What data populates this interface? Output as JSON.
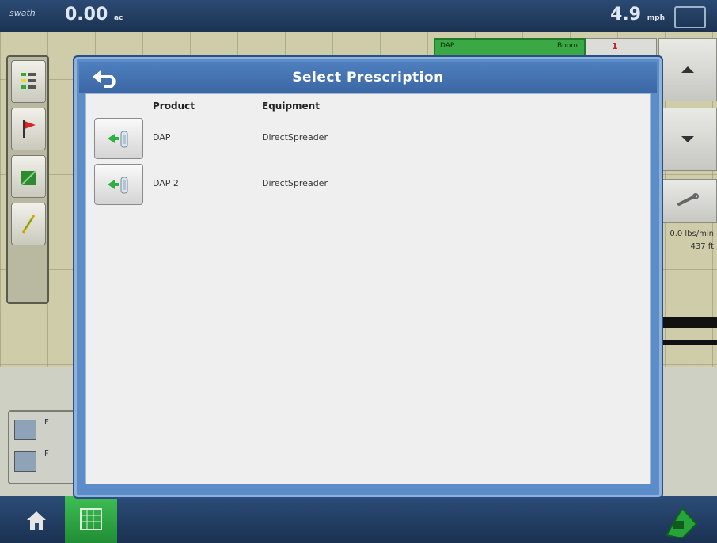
{
  "status_bar": {
    "left_tag": "swath",
    "distance": "0.00",
    "distance_unit": "ac",
    "speed": "4.9",
    "speed_unit": "mph"
  },
  "map_panel": {
    "rx_tab_label": "DAP",
    "rx_tab_right": "Boom",
    "count_label": "1",
    "rate_readout": "0.0 lbs/min",
    "distance_readout": "437 ft",
    "bottom_left_labels": [
      "F",
      "F"
    ]
  },
  "dialog": {
    "title": "Select Prescription",
    "columns": {
      "product": "Product",
      "equipment": "Equipment"
    },
    "rows": [
      {
        "product": "DAP",
        "equipment": "DirectSpreader"
      },
      {
        "product": "DAP 2",
        "equipment": "DirectSpreader"
      }
    ]
  },
  "icons": {
    "back": "back-arrow-icon",
    "select": "prescription-select-icon",
    "home": "home-icon",
    "grid": "grid-icon",
    "run": "run-icon"
  },
  "colors": {
    "modal_frame": "#5b8dc9",
    "title_bar": "#3b67a4",
    "accent_green": "#3aa845",
    "footer": "#1a3152"
  }
}
